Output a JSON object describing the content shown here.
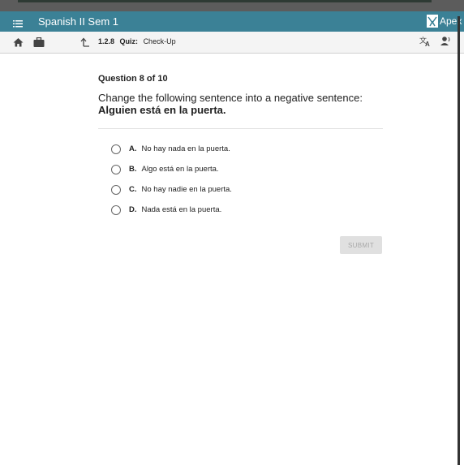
{
  "header": {
    "title": "Spanish II Sem 1",
    "logo_text": "Apex L",
    "accent": "#3b8196"
  },
  "toolbar": {
    "lesson_number": "1.2.8",
    "lesson_type": "Quiz:",
    "lesson_name": "Check-Up"
  },
  "question": {
    "counter": "Question 8 of 10",
    "prompt": "Change the following sentence into a negative sentence:",
    "sentence": "Alguien está en la puerta.",
    "options": [
      {
        "letter": "A.",
        "text": "No hay nada en la puerta."
      },
      {
        "letter": "B.",
        "text": "Algo está en la puerta."
      },
      {
        "letter": "C.",
        "text": "No hay nadie en la puerta."
      },
      {
        "letter": "D.",
        "text": "Nada está en la puerta."
      }
    ],
    "submit_label": "SUBMIT"
  }
}
